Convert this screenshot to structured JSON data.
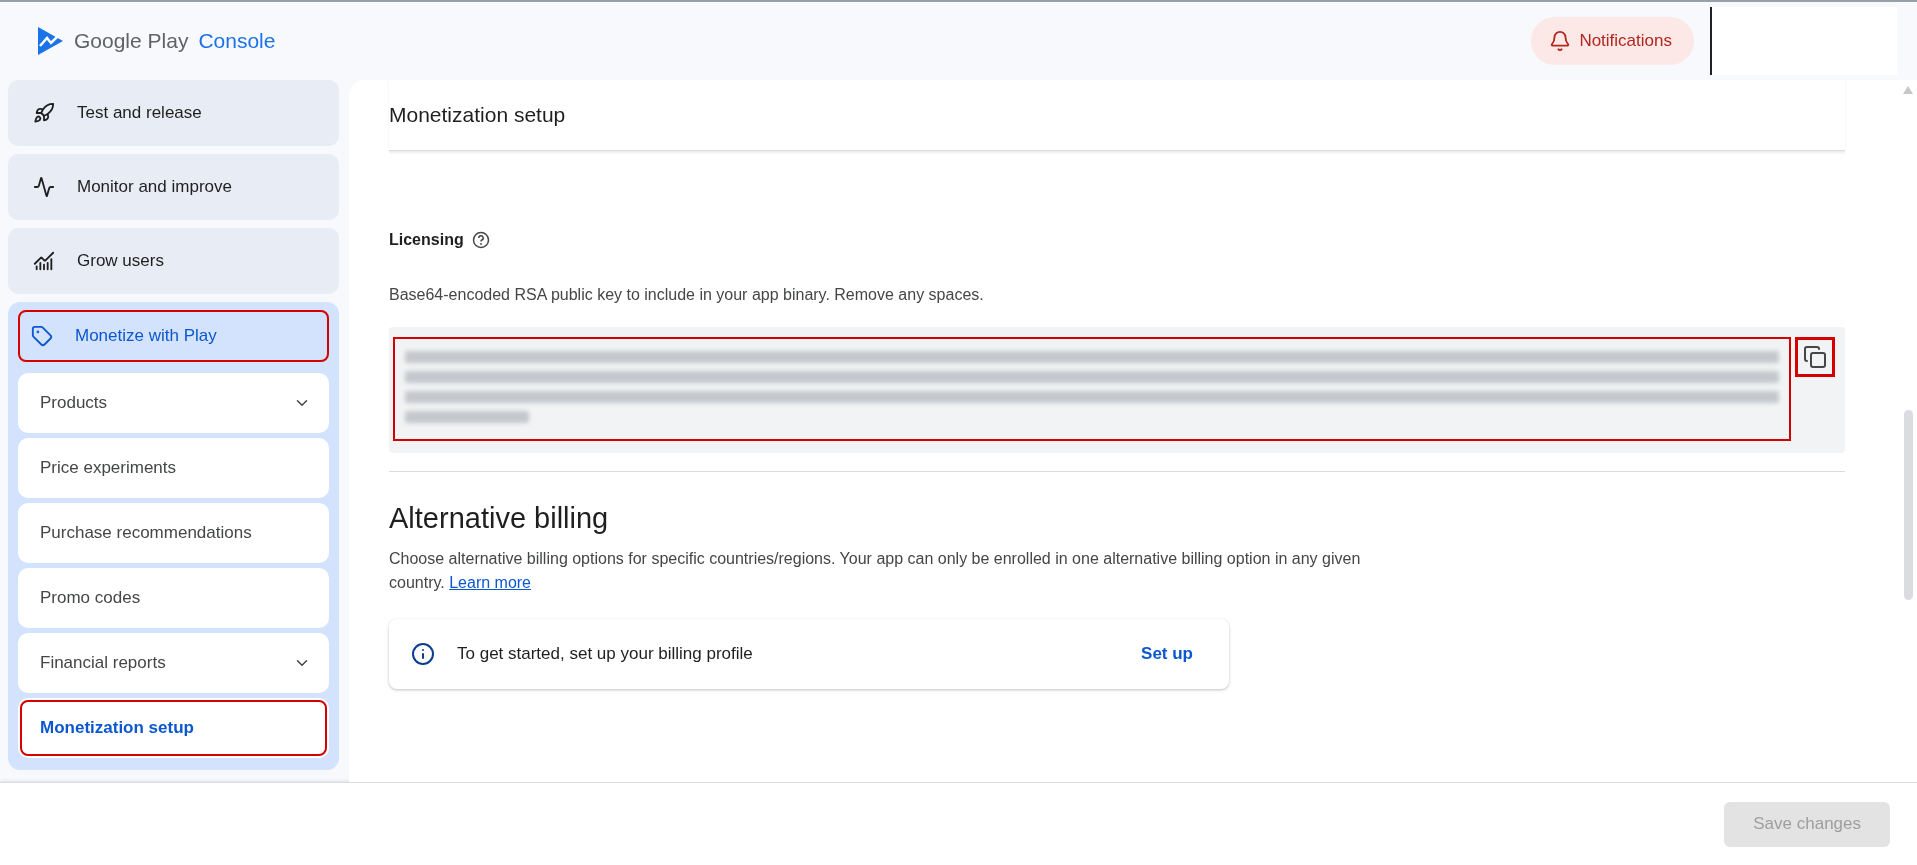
{
  "header": {
    "logo": {
      "brand": "Google Play",
      "product": "Console"
    },
    "notifications": {
      "label": "Notifications"
    }
  },
  "sidebar": {
    "items": [
      {
        "label": "Test and release",
        "selected": false,
        "highlighted": false,
        "expanded": false
      },
      {
        "label": "Monitor and improve",
        "selected": false,
        "highlighted": false,
        "expanded": false
      },
      {
        "label": "Grow users",
        "selected": false,
        "highlighted": false,
        "expanded": false
      },
      {
        "label": "Monetize with Play",
        "selected": true,
        "highlighted": true,
        "expanded": true,
        "children": [
          {
            "label": "Products",
            "expandable": true,
            "selected": false,
            "highlighted": false
          },
          {
            "label": "Price experiments",
            "expandable": false,
            "selected": false,
            "highlighted": false
          },
          {
            "label": "Purchase recommendations",
            "expandable": false,
            "selected": false,
            "highlighted": false
          },
          {
            "label": "Promo codes",
            "expandable": false,
            "selected": false,
            "highlighted": false
          },
          {
            "label": "Financial reports",
            "expandable": true,
            "selected": false,
            "highlighted": false
          },
          {
            "label": "Monetization setup",
            "expandable": false,
            "selected": true,
            "highlighted": true
          }
        ]
      }
    ]
  },
  "page": {
    "title": "Monetization setup",
    "licensing": {
      "heading": "Licensing",
      "description": "Base64-encoded RSA public key to include in your app binary. Remove any spaces.",
      "key_highlighted": true,
      "copy_highlighted": true
    },
    "alternative_billing": {
      "heading": "Alternative billing",
      "description": "Choose alternative billing options for specific countries/regions. Your app can only be enrolled in one alternative billing option in any given country.",
      "link": "Learn more",
      "notice": {
        "text": "To get started, set up your billing profile",
        "action": "Set up"
      }
    }
  },
  "footer": {
    "save_button": {
      "label": "Save changes",
      "disabled": true
    }
  }
}
